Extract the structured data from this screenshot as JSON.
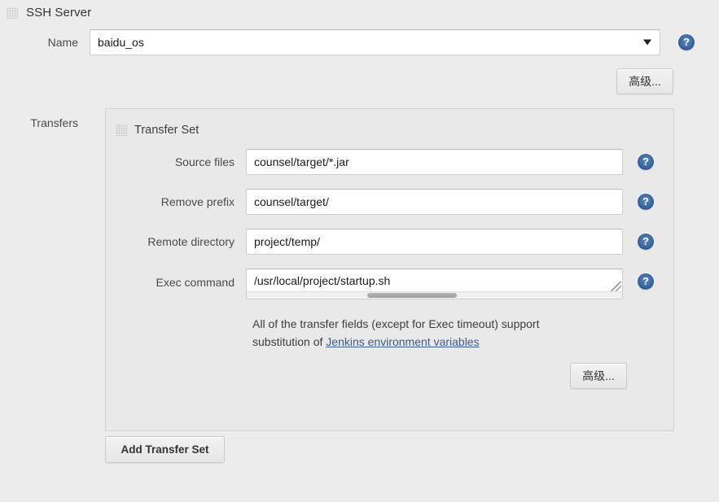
{
  "section": {
    "title": "SSH Server",
    "drag_handle_icon": "drag-grip-icon"
  },
  "name_field": {
    "label": "Name",
    "value": "baidu_os",
    "placeholder": "",
    "caret_icon": "chevron-down-icon",
    "help_icon": "help-icon"
  },
  "advanced_top": {
    "label": "高级..."
  },
  "transfers": {
    "label": "Transfers",
    "panel_title": "Transfer Set",
    "drag_handle_icon": "drag-grip-icon",
    "fields": [
      {
        "label": "Source files",
        "value": "counsel/target/*.jar",
        "placeholder": "",
        "name": "source-files",
        "help_icon": "help-icon"
      },
      {
        "label": "Remove prefix",
        "value": "counsel/target/",
        "placeholder": "",
        "name": "remove-prefix",
        "help_icon": "help-icon"
      },
      {
        "label": "Remote directory",
        "value": "project/temp/",
        "placeholder": "",
        "name": "remote-directory",
        "help_icon": "help-icon"
      }
    ],
    "exec": {
      "label": "Exec command",
      "value": "/usr/local/project/startup.sh",
      "placeholder": "",
      "help_icon": "help-icon"
    },
    "note": {
      "line1": "All of the transfer fields (except for Exec timeout) support",
      "line2_prefix": "substitution of ",
      "link_text": "Jenkins environment variables"
    },
    "advanced_label": "高级...",
    "add_button_label": "Add Transfer Set"
  },
  "colors": {
    "page_bg": "#ececec",
    "panel_bg": "#e9e9e9",
    "input_bg": "#ffffff",
    "link": "#3b5b8c",
    "help_blue": "#3f6ba8"
  }
}
